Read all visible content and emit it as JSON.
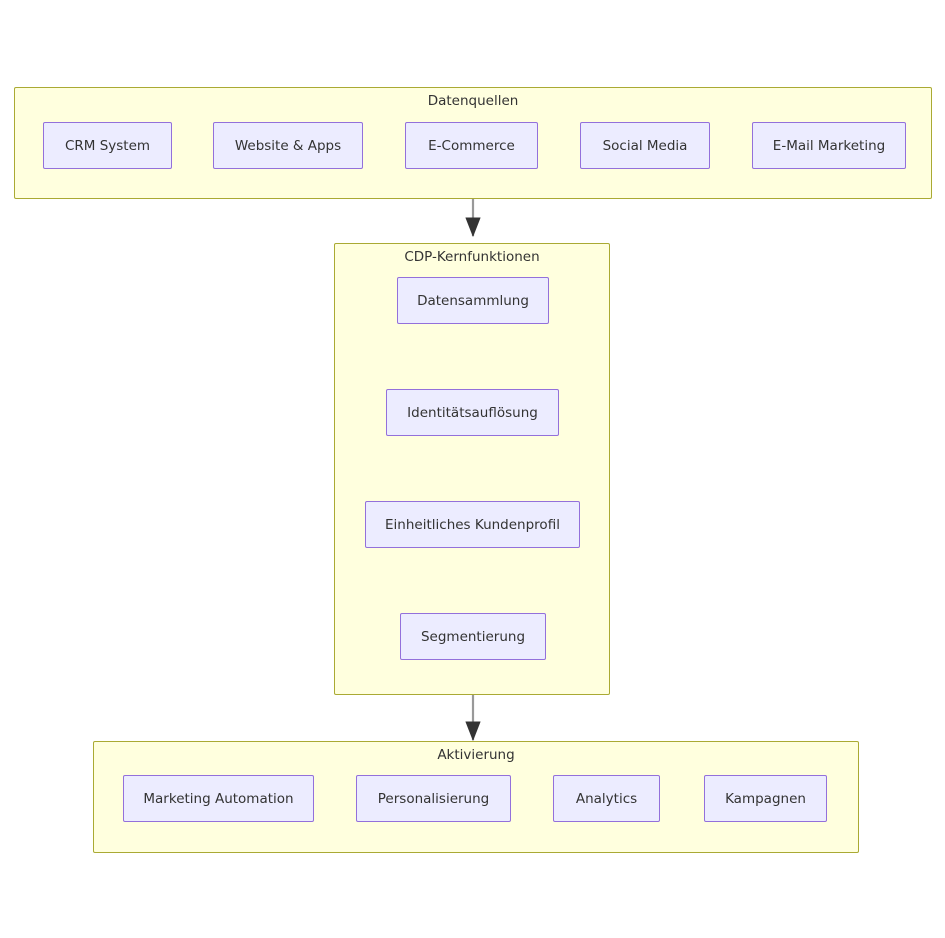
{
  "diagram": {
    "type": "flowchart",
    "direction": "top-to-bottom",
    "language": "de",
    "colors": {
      "cluster_fill": "#ffffde",
      "cluster_stroke": "#aaaa33",
      "node_fill": "#ececff",
      "node_stroke": "#9370db",
      "node_text": "#333333",
      "inner_edge": "#333333",
      "cluster_edge": "#999999",
      "background": "#ffffff"
    },
    "clusters": [
      {
        "id": "datenquellen",
        "label": "Datenquellen",
        "nodes": [
          {
            "id": "crm",
            "label": "CRM System"
          },
          {
            "id": "web",
            "label": "Website & Apps"
          },
          {
            "id": "ecom",
            "label": "E-Commerce"
          },
          {
            "id": "social",
            "label": "Social Media"
          },
          {
            "id": "email",
            "label": "E-Mail Marketing"
          }
        ]
      },
      {
        "id": "cdp",
        "label": "CDP-Kernfunktionen",
        "nodes": [
          {
            "id": "sammlung",
            "label": "Datensammlung"
          },
          {
            "id": "identity",
            "label": "Identitätsauflösung"
          },
          {
            "id": "profil",
            "label": "Einheitliches Kundenprofil"
          },
          {
            "id": "segment",
            "label": "Segmentierung"
          }
        ]
      },
      {
        "id": "aktivierung",
        "label": "Aktivierung",
        "nodes": [
          {
            "id": "mktauto",
            "label": "Marketing Automation"
          },
          {
            "id": "perso",
            "label": "Personalisierung"
          },
          {
            "id": "analytics",
            "label": "Analytics"
          },
          {
            "id": "kampagnen",
            "label": "Kampagnen"
          }
        ]
      }
    ],
    "edges": [
      {
        "from": "datenquellen",
        "to": "cdp",
        "kind": "cluster"
      },
      {
        "from": "sammlung",
        "to": "identity",
        "kind": "inner"
      },
      {
        "from": "identity",
        "to": "profil",
        "kind": "inner"
      },
      {
        "from": "profil",
        "to": "segment",
        "kind": "inner"
      },
      {
        "from": "cdp",
        "to": "aktivierung",
        "kind": "cluster"
      }
    ]
  }
}
